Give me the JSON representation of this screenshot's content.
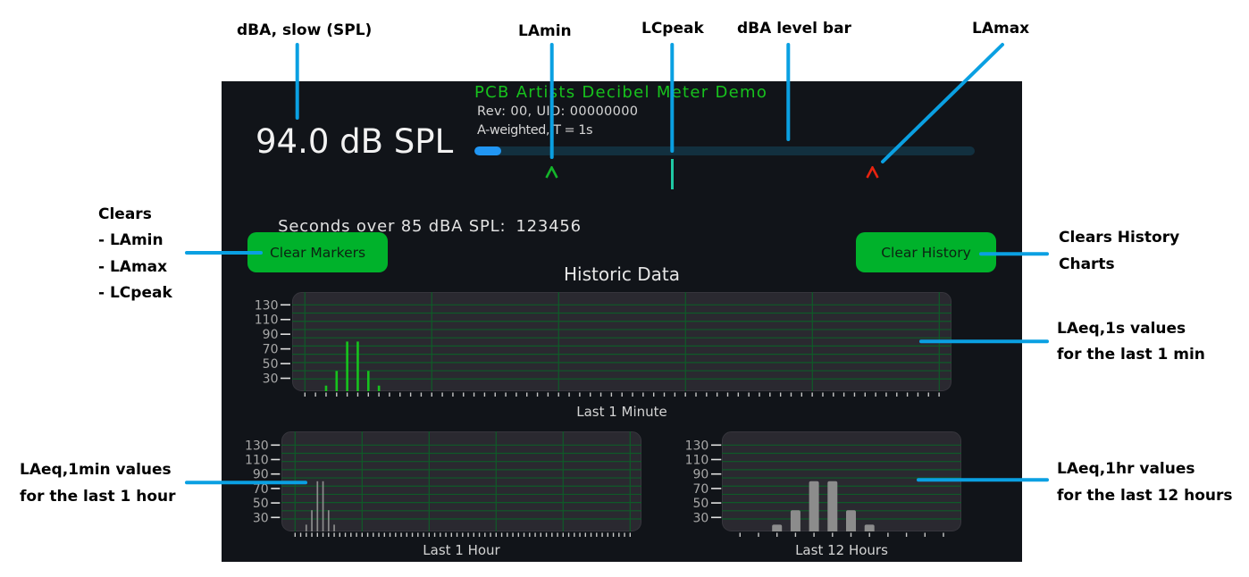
{
  "app": {
    "title": "PCB Artists Decibel Meter Demo",
    "rev_line": "Rev: 00, UID: 00000000",
    "weighting_line": "A-weighted, T = 1s"
  },
  "meter": {
    "spl_reading": "94.0 dB SPL",
    "level_bar_fraction": 0.054,
    "markers": {
      "lamin_fraction": 0.154,
      "lcpeak_fraction": 0.395,
      "lamax_fraction": 0.796
    },
    "seconds_over_label": "Seconds over 85 dBA SPL:",
    "seconds_over_value": "123456"
  },
  "buttons": {
    "clear_markers": "Clear Markers",
    "clear_history": "Clear History"
  },
  "history": {
    "title": "Historic Data"
  },
  "annotations": {
    "spl": "dBA, slow (SPL)",
    "lamin": "LAmin",
    "lcpeak": "LCpeak",
    "level_bar": "dBA level bar",
    "lamax": "LAmax",
    "clear_markers": [
      "Clears",
      "- LAmin",
      "- LAmax",
      "- LCpeak"
    ],
    "clear_history": [
      "Clears History",
      "Charts"
    ],
    "chart_1s": [
      "LAeq,1s values",
      "for the last 1 min"
    ],
    "chart_1min": [
      "LAeq,1min values",
      "for the last 1 hour"
    ],
    "chart_1hr": [
      "LAeq,1hr values",
      "for the last 12 hours"
    ]
  },
  "colors": {
    "screen_bg": "#111419",
    "title_green": "#17c21d",
    "button_green": "#00b22b",
    "level_track": "#12303f",
    "level_fill": "#2196f3",
    "lamin_marker": "#14b52a",
    "lcpeak_marker": "#1fc9a4",
    "lamax_marker": "#e8230f",
    "chart_bg": "#2a2930",
    "chart_border": "#37363d",
    "grid_green": "#0f5a28",
    "bar_green": "#17c21d",
    "bar_gray": "#8c8c8c",
    "tick": "#c8c8c8",
    "y_tick_mark": "#e0e0e0",
    "annotation_line": "#0aa0e2"
  },
  "chart_data": [
    {
      "type": "bar",
      "title": "Last 1 Minute",
      "xlabel": "Last 1 Minute",
      "ylabel": "",
      "series_name": "LAeq,1s",
      "y_ticks": [
        130,
        110,
        90,
        70,
        50,
        30
      ],
      "ylim": [
        10,
        130
      ],
      "grid": true,
      "x_ticks": 61,
      "values": [
        null,
        null,
        20,
        40,
        80,
        80,
        40,
        20,
        null,
        null,
        null,
        null,
        null,
        null,
        null,
        null,
        null,
        null,
        null,
        null,
        null,
        null,
        null,
        null,
        null,
        null,
        null,
        null,
        null,
        null,
        null,
        null,
        null,
        null,
        null,
        null,
        null,
        null,
        null,
        null,
        null,
        null,
        null,
        null,
        null,
        null,
        null,
        null,
        null,
        null,
        null,
        null,
        null,
        null,
        null,
        null,
        null,
        null,
        null,
        null,
        null
      ]
    },
    {
      "type": "bar",
      "title": "Last 1 Hour",
      "xlabel": "Last 1 Hour",
      "ylabel": "",
      "series_name": "LAeq,1min",
      "y_ticks": [
        130,
        110,
        90,
        70,
        50,
        30
      ],
      "ylim": [
        10,
        130
      ],
      "grid": true,
      "x_ticks": 61,
      "values": [
        null,
        null,
        20,
        40,
        80,
        80,
        40,
        20,
        null,
        null,
        null,
        null,
        null,
        null,
        null,
        null,
        null,
        null,
        null,
        null,
        null,
        null,
        null,
        null,
        null,
        null,
        null,
        null,
        null,
        null,
        null,
        null,
        null,
        null,
        null,
        null,
        null,
        null,
        null,
        null,
        null,
        null,
        null,
        null,
        null,
        null,
        null,
        null,
        null,
        null,
        null,
        null,
        null,
        null,
        null,
        null,
        null,
        null,
        null,
        null,
        null
      ]
    },
    {
      "type": "bar",
      "title": "Last 12 Hours",
      "xlabel": "Last 12 Hours",
      "ylabel": "",
      "series_name": "LAeq,1hr",
      "y_ticks": [
        130,
        110,
        90,
        70,
        50,
        30
      ],
      "ylim": [
        10,
        130
      ],
      "grid": true,
      "x_ticks": 12,
      "values": [
        null,
        null,
        20,
        40,
        80,
        80,
        40,
        20,
        null,
        null,
        null,
        null
      ]
    }
  ]
}
